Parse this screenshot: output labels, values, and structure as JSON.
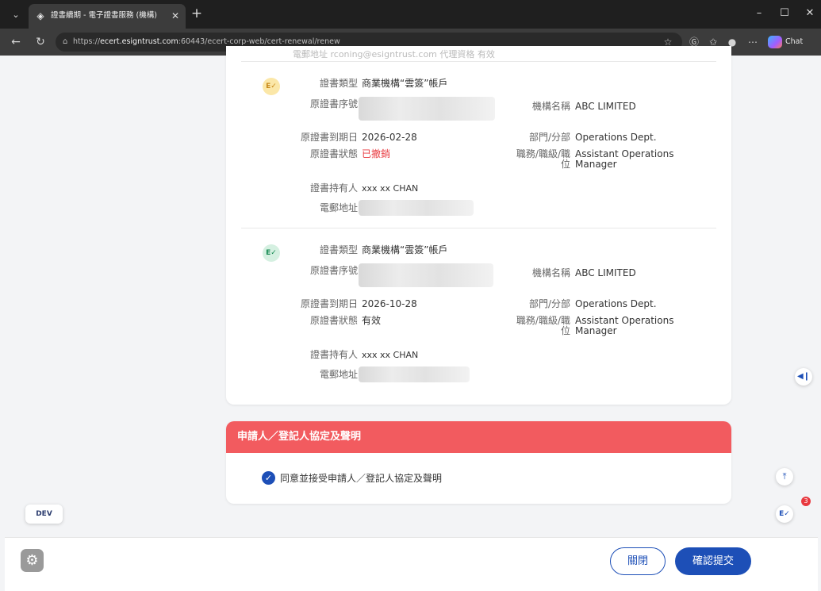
{
  "browser": {
    "tab_title": "證書續期 - 電子證書服務 (機構)",
    "url_prefix": "https://",
    "url_host": "ecert.esigntrust.com",
    "url_path": ":60443/ecert-corp-web/cert-renewal/renew",
    "chat_label": "Chat",
    "icons": {
      "tab_menu": "chevron-down-icon",
      "favicon": "diamond-icon",
      "tab_close": "close-icon",
      "new_tab": "plus-icon",
      "minimize": "minimize-icon",
      "maximize": "maximize-icon",
      "close_window": "close-icon",
      "back": "arrow-left-icon",
      "reload": "reload-icon",
      "lock": "lock-icon",
      "favorite": "star-icon"
    }
  },
  "page": {
    "cut_off_text": "電郵地址 rconing@esigntrust.com     代理資格 有效",
    "certificates": [
      {
        "icon": "certificate-icon",
        "icon_color": "#c8891a",
        "cert_type_label": "證書類型",
        "cert_type": "商業機構“雲簽”帳戶",
        "serial_label": "原證書序號",
        "org_label": "機構名稱",
        "org": "ABC LIMITED",
        "expiry_label": "原證書到期日",
        "expiry": "2026-02-28",
        "dept_label": "部門/分部",
        "dept": "Operations Dept.",
        "status_label": "原證書狀態",
        "status": "已撤銷",
        "status_color": "#e8393f",
        "position_label": "職務/職級/職位",
        "position": "Assistant Operations Manager",
        "holder_label": "證書持有人",
        "holder": "xxx xx CHAN",
        "email_label": "電郵地址"
      },
      {
        "icon": "certificate-icon",
        "icon_color": "#168a52",
        "cert_type_label": "證書類型",
        "cert_type": "商業機構“雲簽”帳戶",
        "serial_label": "原證書序號",
        "org_label": "機構名稱",
        "org": "ABC LIMITED",
        "expiry_label": "原證書到期日",
        "expiry": "2026-10-28",
        "dept_label": "部門/分部",
        "dept": "Operations Dept.",
        "status_label": "原證書狀態",
        "status": "有效",
        "status_color": "#333333",
        "position_label": "職務/職級/職位",
        "position": "Assistant Operations Manager",
        "holder_label": "證書持有人",
        "holder": "xxx xx CHAN",
        "email_label": "電郵地址"
      }
    ],
    "agreement": {
      "title": "申請人／登記人協定及聲明",
      "checkbox_label": "同意並接受申請人／登記人協定及聲明",
      "checked": true,
      "header_color": "#f25b5f"
    },
    "dev_badge": "DEV",
    "notification_count": "3",
    "side_icons": {
      "collapse": "collapse-left-icon",
      "top": "scroll-top-icon",
      "notification": "certificate-icon",
      "settings": "gear-icon"
    }
  },
  "footer": {
    "close_label": "關閉",
    "submit_label": "確認提交",
    "accent": "#1d4fb7"
  }
}
